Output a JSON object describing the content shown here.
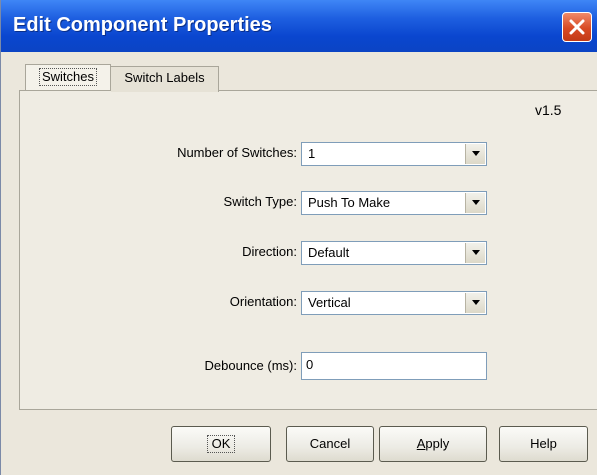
{
  "window": {
    "title": "Edit Component Properties"
  },
  "tabs": [
    {
      "label": "Switches",
      "active": true
    },
    {
      "label": "Switch Labels",
      "active": false
    }
  ],
  "panel": {
    "version": "v1.5",
    "fields": {
      "number_of_switches": {
        "label": "Number of Switches:",
        "value": "1"
      },
      "switch_type": {
        "label": "Switch Type:",
        "value": "Push To Make"
      },
      "direction": {
        "label": "Direction:",
        "value": "Default"
      },
      "orientation": {
        "label": "Orientation:",
        "value": "Vertical"
      },
      "debounce": {
        "label": "Debounce (ms):",
        "value": "0"
      }
    }
  },
  "buttons": {
    "ok": "OK",
    "cancel": "Cancel",
    "apply_first": "A",
    "apply_rest": "pply",
    "help": "Help"
  },
  "icons": {
    "close": "close-icon",
    "dropdown": "chevron-down-icon"
  },
  "colors": {
    "titlebar": "#0a46cf",
    "close_button": "#d84a24",
    "window_bg": "#ebe7dc"
  }
}
